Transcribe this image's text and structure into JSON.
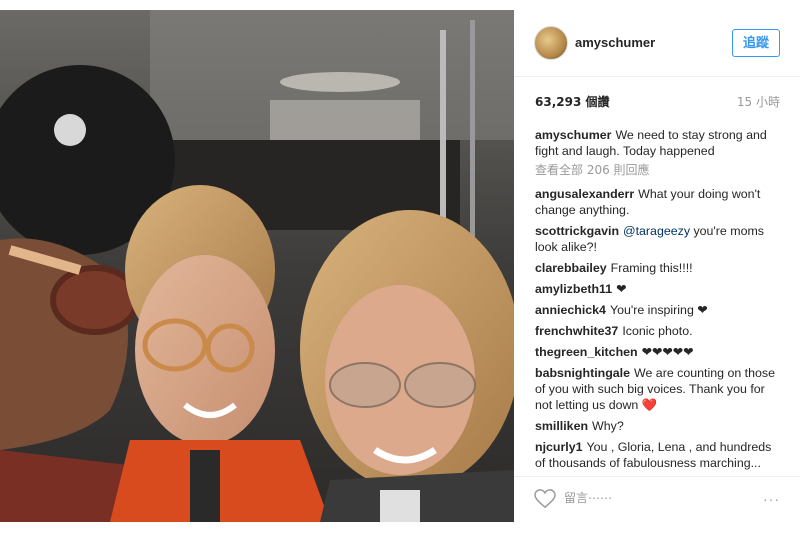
{
  "header": {
    "username": "amyschumer",
    "follow_label": "追蹤"
  },
  "stats": {
    "views": "63,293 個讚",
    "time": "15 小時"
  },
  "caption": {
    "user": "amyschumer",
    "text": "We need to stay strong and fight and laugh. Today happened"
  },
  "view_all": "查看全部 206 則回應",
  "comments": [
    {
      "user": "angusalexanderr",
      "text": "What your doing won't change anything."
    },
    {
      "user": "scottrickgavin",
      "mention": "@tarageezy",
      "text": " you're moms look alike?!"
    },
    {
      "user": "clarebbailey",
      "text": "Framing this!!!!"
    },
    {
      "user": "amylizbeth11",
      "text": "❤"
    },
    {
      "user": "anniechick4",
      "text": "You're inspiring ❤"
    },
    {
      "user": "frenchwhite37",
      "text": "Iconic photo."
    },
    {
      "user": "thegreen_kitchen",
      "text": "❤❤❤❤❤"
    },
    {
      "user": "babsnightingale",
      "text": "We are counting on those of you with such big voices. Thank you for not letting us down ❤️"
    },
    {
      "user": "smilliken",
      "text": "Why?"
    },
    {
      "user": "njcurly1",
      "text": "You , Gloria, Lena , and hundreds of thousands of fabulousness marching..."
    }
  ],
  "footer": {
    "comment_placeholder": "留言⋯⋯",
    "more_label": "···",
    "like_icon": "heart-outline-icon"
  },
  "colors": {
    "accent": "#3897f0",
    "heart_red": "#ed4956",
    "muted": "#999999"
  }
}
